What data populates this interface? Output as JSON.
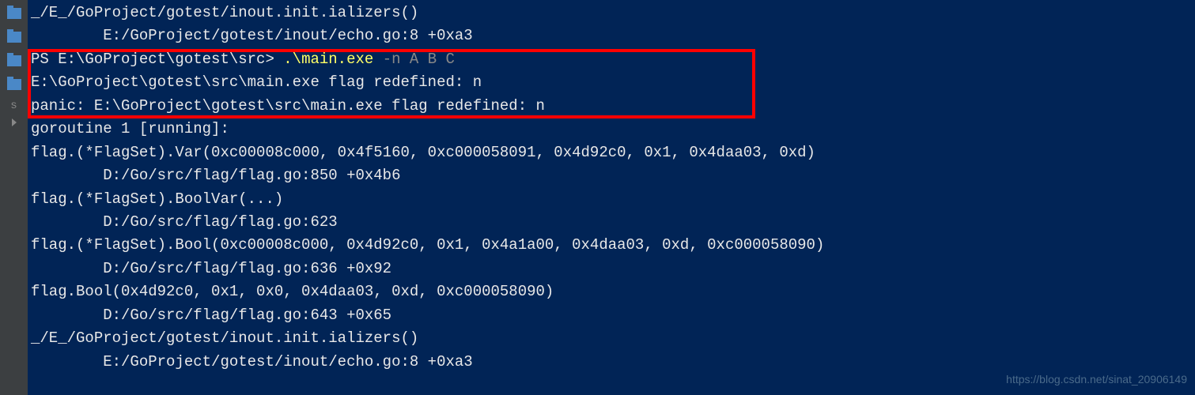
{
  "sidebar": {
    "s_label": "s"
  },
  "terminal": {
    "lines": {
      "l0": "_/E_/GoProject/gotest/inout.init.ializers()",
      "l1": "        E:/GoProject/gotest/inout/echo.go:8 +0xa3",
      "l2_prompt": "PS E:\\GoProject\\gotest\\src> ",
      "l2_cmd": ".\\main.exe",
      "l2_args": " -n A B C",
      "l3": "E:\\GoProject\\gotest\\src\\main.exe flag redefined: n",
      "l4": "panic: E:\\GoProject\\gotest\\src\\main.exe flag redefined: n",
      "l5": "",
      "l6": "goroutine 1 [running]:",
      "l7": "flag.(*FlagSet).Var(0xc00008c000, 0x4f5160, 0xc000058091, 0x4d92c0, 0x1, 0x4daa03, 0xd)",
      "l8": "        D:/Go/src/flag/flag.go:850 +0x4b6",
      "l9": "flag.(*FlagSet).BoolVar(...)",
      "l10": "        D:/Go/src/flag/flag.go:623",
      "l11": "flag.(*FlagSet).Bool(0xc00008c000, 0x4d92c0, 0x1, 0x4a1a00, 0x4daa03, 0xd, 0xc000058090)",
      "l12": "        D:/Go/src/flag/flag.go:636 +0x92",
      "l13": "flag.Bool(0x4d92c0, 0x1, 0x0, 0x4daa03, 0xd, 0xc000058090)",
      "l14": "        D:/Go/src/flag/flag.go:643 +0x65",
      "l15": "_/E_/GoProject/gotest/inout.init.ializers()",
      "l16": "        E:/GoProject/gotest/inout/echo.go:8 +0xa3"
    }
  },
  "watermark": "https://blog.csdn.net/sinat_20906149"
}
